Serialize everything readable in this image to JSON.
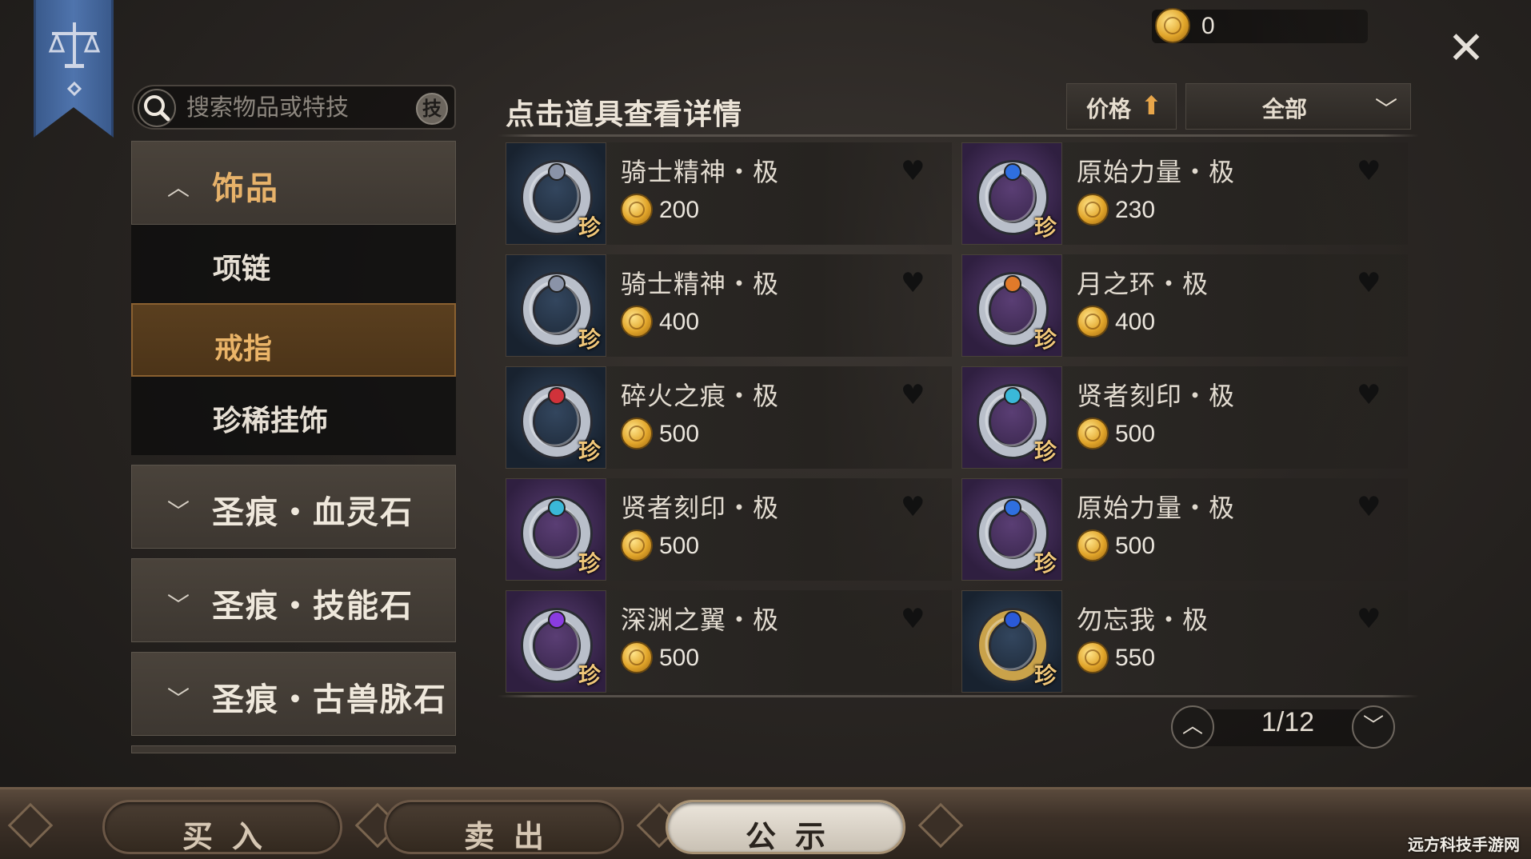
{
  "wallet": {
    "coins": "0"
  },
  "search": {
    "placeholder": "搜索物品或特技",
    "skill_label": "技"
  },
  "sidebar": {
    "categories": [
      {
        "label": "饰品",
        "expanded": true,
        "children": [
          "项链",
          "戒指",
          "珍稀挂饰"
        ],
        "selected": "戒指"
      },
      {
        "label": "圣痕・血灵石",
        "expanded": false
      },
      {
        "label": "圣痕・技能石",
        "expanded": false
      },
      {
        "label": "圣痕・古兽脉石",
        "expanded": false
      }
    ]
  },
  "main": {
    "title": "点击道具查看详情",
    "sort_label": "价格",
    "sort_direction": "ascending",
    "filter_label": "全部"
  },
  "items": [
    {
      "name": "骑士精神・极",
      "price": "200",
      "rarity": "珍",
      "bg": "blue",
      "icon": "silver-ring-icon"
    },
    {
      "name": "原始力量・极",
      "price": "230",
      "rarity": "珍",
      "bg": "purple",
      "icon": "blue-gem-ring-icon"
    },
    {
      "name": "骑士精神・极",
      "price": "400",
      "rarity": "珍",
      "bg": "blue",
      "icon": "silver-ring-icon"
    },
    {
      "name": "月之环・极",
      "price": "400",
      "rarity": "珍",
      "bg": "purple",
      "icon": "moon-ring-icon"
    },
    {
      "name": "碎火之痕・极",
      "price": "500",
      "rarity": "珍",
      "bg": "blue",
      "icon": "red-rune-ring-icon"
    },
    {
      "name": "贤者刻印・极",
      "price": "500",
      "rarity": "珍",
      "bg": "purple",
      "icon": "sage-ring-icon"
    },
    {
      "name": "贤者刻印・极",
      "price": "500",
      "rarity": "珍",
      "bg": "purple",
      "icon": "sage-ring-icon"
    },
    {
      "name": "原始力量・极",
      "price": "500",
      "rarity": "珍",
      "bg": "purple",
      "icon": "blue-gem-ring-icon"
    },
    {
      "name": "深渊之翼・极",
      "price": "500",
      "rarity": "珍",
      "bg": "purple",
      "icon": "abyss-wing-ring-icon"
    },
    {
      "name": "勿忘我・极",
      "price": "550",
      "rarity": "珍",
      "bg": "blue",
      "icon": "gold-sapphire-ring-icon"
    }
  ],
  "pager": {
    "text": "1/12"
  },
  "bottom_tabs": [
    {
      "label": "买入",
      "active": false
    },
    {
      "label": "卖出",
      "active": false
    },
    {
      "label": "公示",
      "active": true
    }
  ],
  "watermark": "远方科技手游网",
  "colors": {
    "accent": "#e7b26a",
    "selected_bg": "#5a3f1f",
    "coin": "#e1a52a",
    "banner": "#4f74ad"
  }
}
